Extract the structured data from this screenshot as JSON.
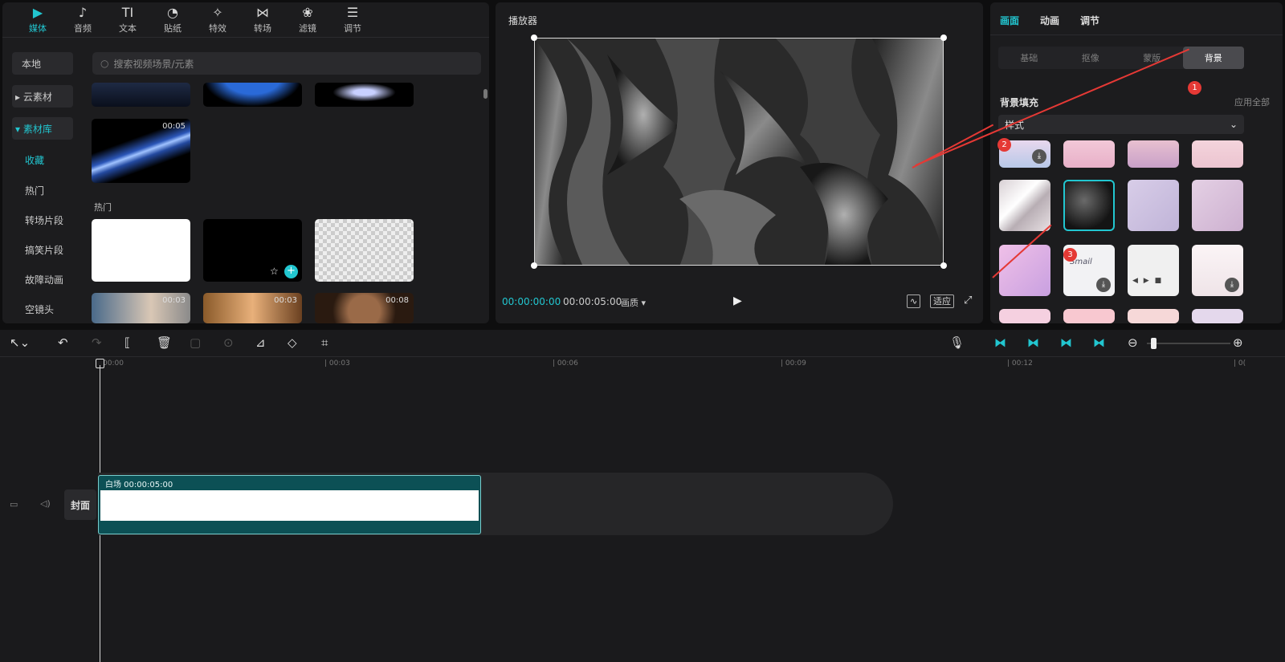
{
  "media_panel": {
    "tabs": [
      {
        "label": "媒体",
        "icon": "media-play-icon",
        "glyph": "▶"
      },
      {
        "label": "音频",
        "icon": "music-note-icon",
        "glyph": "♪"
      },
      {
        "label": "文本",
        "icon": "text-icon",
        "glyph": "TI"
      },
      {
        "label": "贴纸",
        "icon": "sticker-icon",
        "glyph": "◔"
      },
      {
        "label": "特效",
        "icon": "effects-star-icon",
        "glyph": "✧"
      },
      {
        "label": "转场",
        "icon": "transition-icon",
        "glyph": "⋈"
      },
      {
        "label": "滤镜",
        "icon": "filter-circles-icon",
        "glyph": "❀"
      },
      {
        "label": "调节",
        "icon": "adjust-sliders-icon",
        "glyph": "☰"
      }
    ],
    "sidebar": [
      "本地",
      "▸ 云素材",
      "▾ 素材库",
      "收藏",
      "热门",
      "转场片段",
      "搞笑片段",
      "故障动画",
      "空镜头"
    ],
    "search_placeholder": "搜索视频场景/元素",
    "thumb_duration": "00:05",
    "section_hot": "热门",
    "durations_row": [
      "00:03",
      "00:03",
      "00:08"
    ]
  },
  "player": {
    "title": "播放器",
    "time_current": "00:00:00:00",
    "time_total": "00:00:05:00",
    "quality": "画质 ▾",
    "fit_label": "适应"
  },
  "properties": {
    "tabs": [
      "画面",
      "动画",
      "调节"
    ],
    "subtabs": [
      "基础",
      "抠像",
      "蒙版",
      "背景"
    ],
    "fill_title": "背景填充",
    "apply_all": "应用全部",
    "style_select": "样式",
    "badges": [
      "1",
      "2",
      "3"
    ]
  },
  "timeline": {
    "ruler": [
      "00:00",
      "| 00:03",
      "| 00:06",
      "| 00:09",
      "| 00:12",
      "| 0("
    ],
    "cover_label": "封面",
    "clip_label": "白场    00:00:05:00"
  },
  "colors": {
    "accent": "#22c6d0",
    "clip": "#0c5055",
    "annotation": "#e53935"
  }
}
